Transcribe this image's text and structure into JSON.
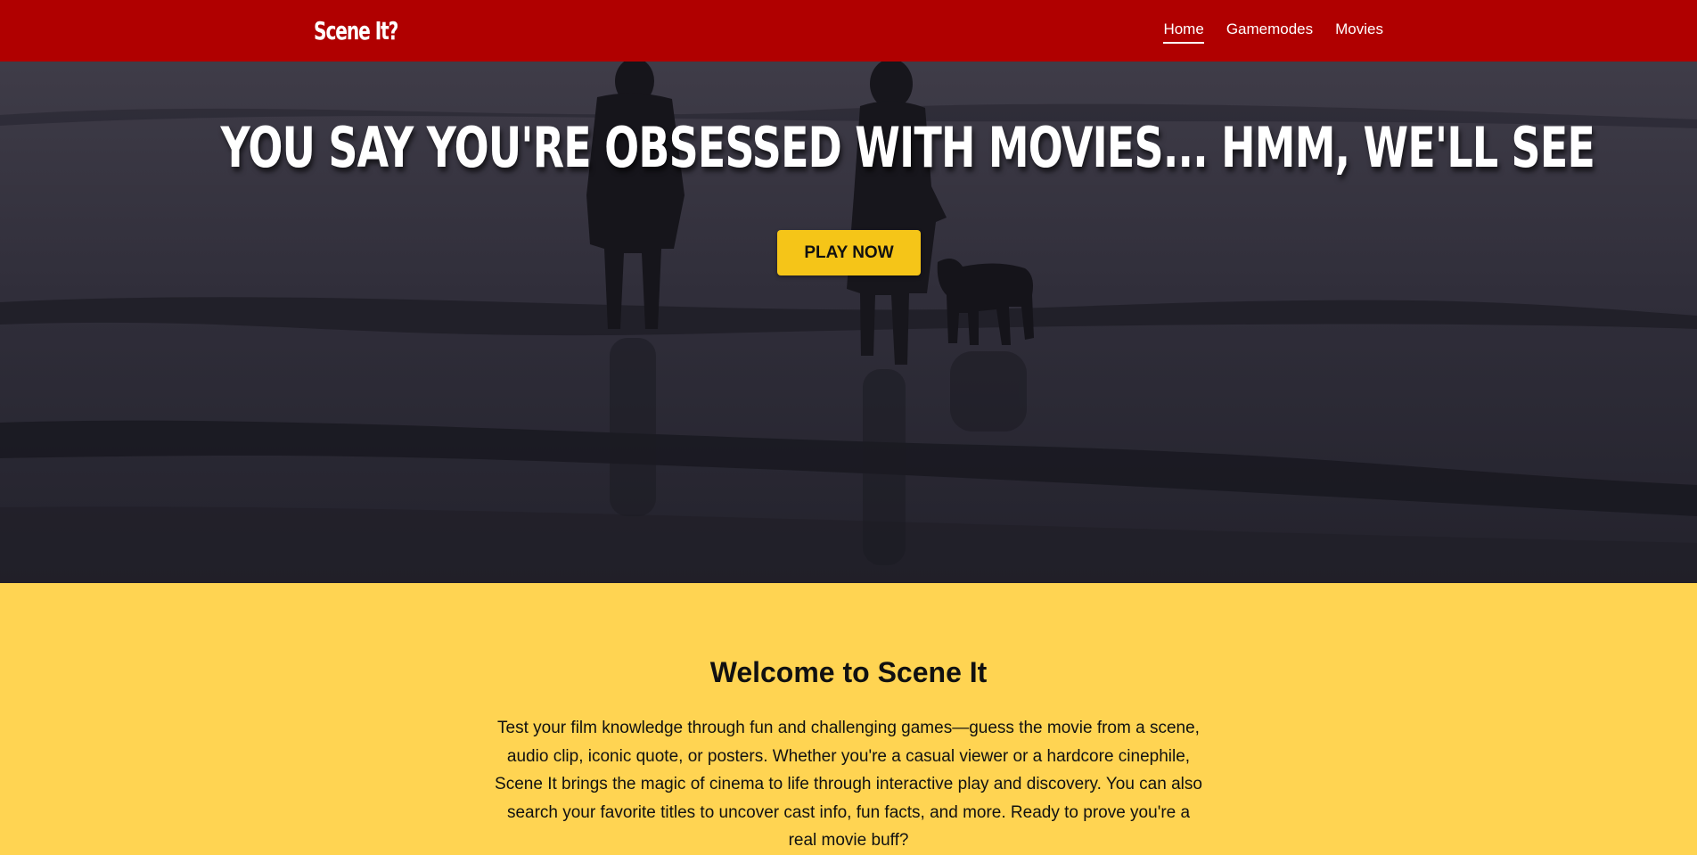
{
  "navbar": {
    "logo": "Scene It?",
    "links": [
      {
        "label": "Home",
        "active": true
      },
      {
        "label": "Gamemodes",
        "active": false
      },
      {
        "label": "Movies",
        "active": false
      }
    ],
    "background_color": "#b00000"
  },
  "hero": {
    "title": "YOU SAY YOU'RE OBSESSED WITH MOVIES... HMM, WE'LL SEE",
    "cta_label": "PLAY NOW",
    "cta_color": "#f5c518"
  },
  "welcome": {
    "title": "Welcome to Scene It",
    "text": "Test your film knowledge through fun and challenging games—guess the movie from a scene, audio clip, iconic quote, or posters. Whether you're a casual viewer or a hardcore cinephile, Scene It brings the magic of cinema to life through interactive play and discovery. You can also search your favorite titles to uncover cast info, fun facts, and more. Ready to prove you're a real movie buff?",
    "background_color": "#ffd452"
  }
}
